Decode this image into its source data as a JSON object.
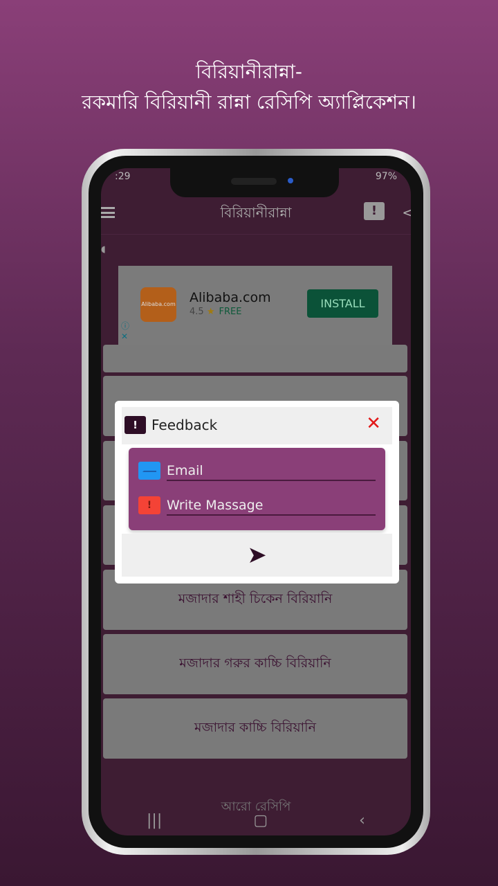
{
  "headline": {
    "line1": "বিরিয়ানীরান্না-",
    "line2": "রকমারি বিরিয়ানী রান্না রেসিপি অ্যাপ্লিকেশন।"
  },
  "status": {
    "time": ":29",
    "battery": "97%"
  },
  "appbar": {
    "title": "বিরিয়ানীরান্না",
    "feedback_icon": "!"
  },
  "ad": {
    "app_name": "Alibaba.com",
    "rating": "4.5",
    "price": "FREE",
    "install_label": "INSTALL",
    "logo_text": "Alibaba.com"
  },
  "cards": [
    "মজাদার শাহী চিকেন বিরিয়ানি",
    "মজাদার গরুর কাচ্চি বিরিয়ানি",
    "মজাদার কাচ্চি বিরিয়ানি"
  ],
  "more_label": "আরো রেসিপি",
  "dialog": {
    "title": "Feedback",
    "email_placeholder": "Email",
    "message_placeholder": "Write Massage"
  },
  "colors": {
    "primary": "#8a3f78",
    "dark": "#2e0e26",
    "close": "#e21a1a",
    "install": "#0b5238"
  }
}
